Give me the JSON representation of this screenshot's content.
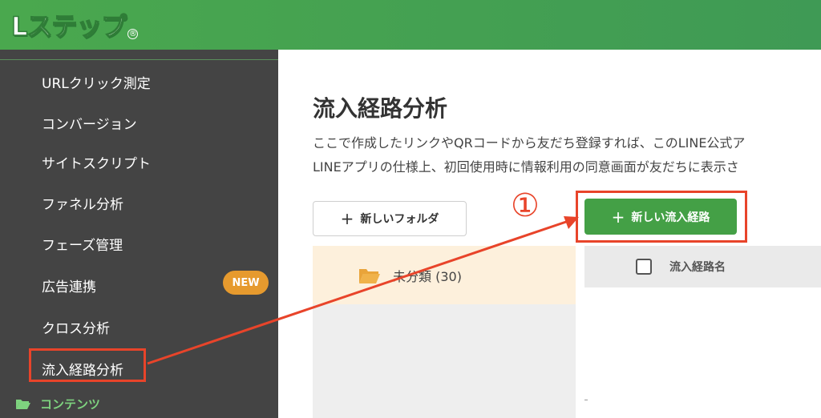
{
  "header": {
    "logo_text": "Lステップ",
    "logo_reg": "®"
  },
  "sidebar": {
    "items": [
      {
        "label": "URLクリック測定"
      },
      {
        "label": "コンバージョン"
      },
      {
        "label": "サイトスクリプト"
      },
      {
        "label": "ファネル分析"
      },
      {
        "label": "フェーズ管理"
      },
      {
        "label": "広告連携"
      },
      {
        "label": "クロス分析"
      },
      {
        "label": "流入経路分析"
      }
    ],
    "new_badge": "NEW",
    "footer_label": "コンテンツ"
  },
  "main": {
    "title": "流入経路分析",
    "desc_line1": "ここで作成したリンクやQRコードから友だち登録すれば、このLINE公式ア",
    "desc_line2": "LINEアプリの仕様上、初回使用時に情報利用の同意画面が友だちに表示さ",
    "new_folder_button": "新しいフォルダ",
    "new_route_button": "新しい流入経路",
    "folder_label": "未分類 (30)",
    "column_name": "流入経路名"
  },
  "annotation": {
    "step_marker": "①"
  },
  "colors": {
    "header_green": "#4aa84e",
    "sidebar_bg": "#444444",
    "accent_red": "#e8442a",
    "button_green": "#44a046",
    "badge_orange": "#e69a2e"
  }
}
